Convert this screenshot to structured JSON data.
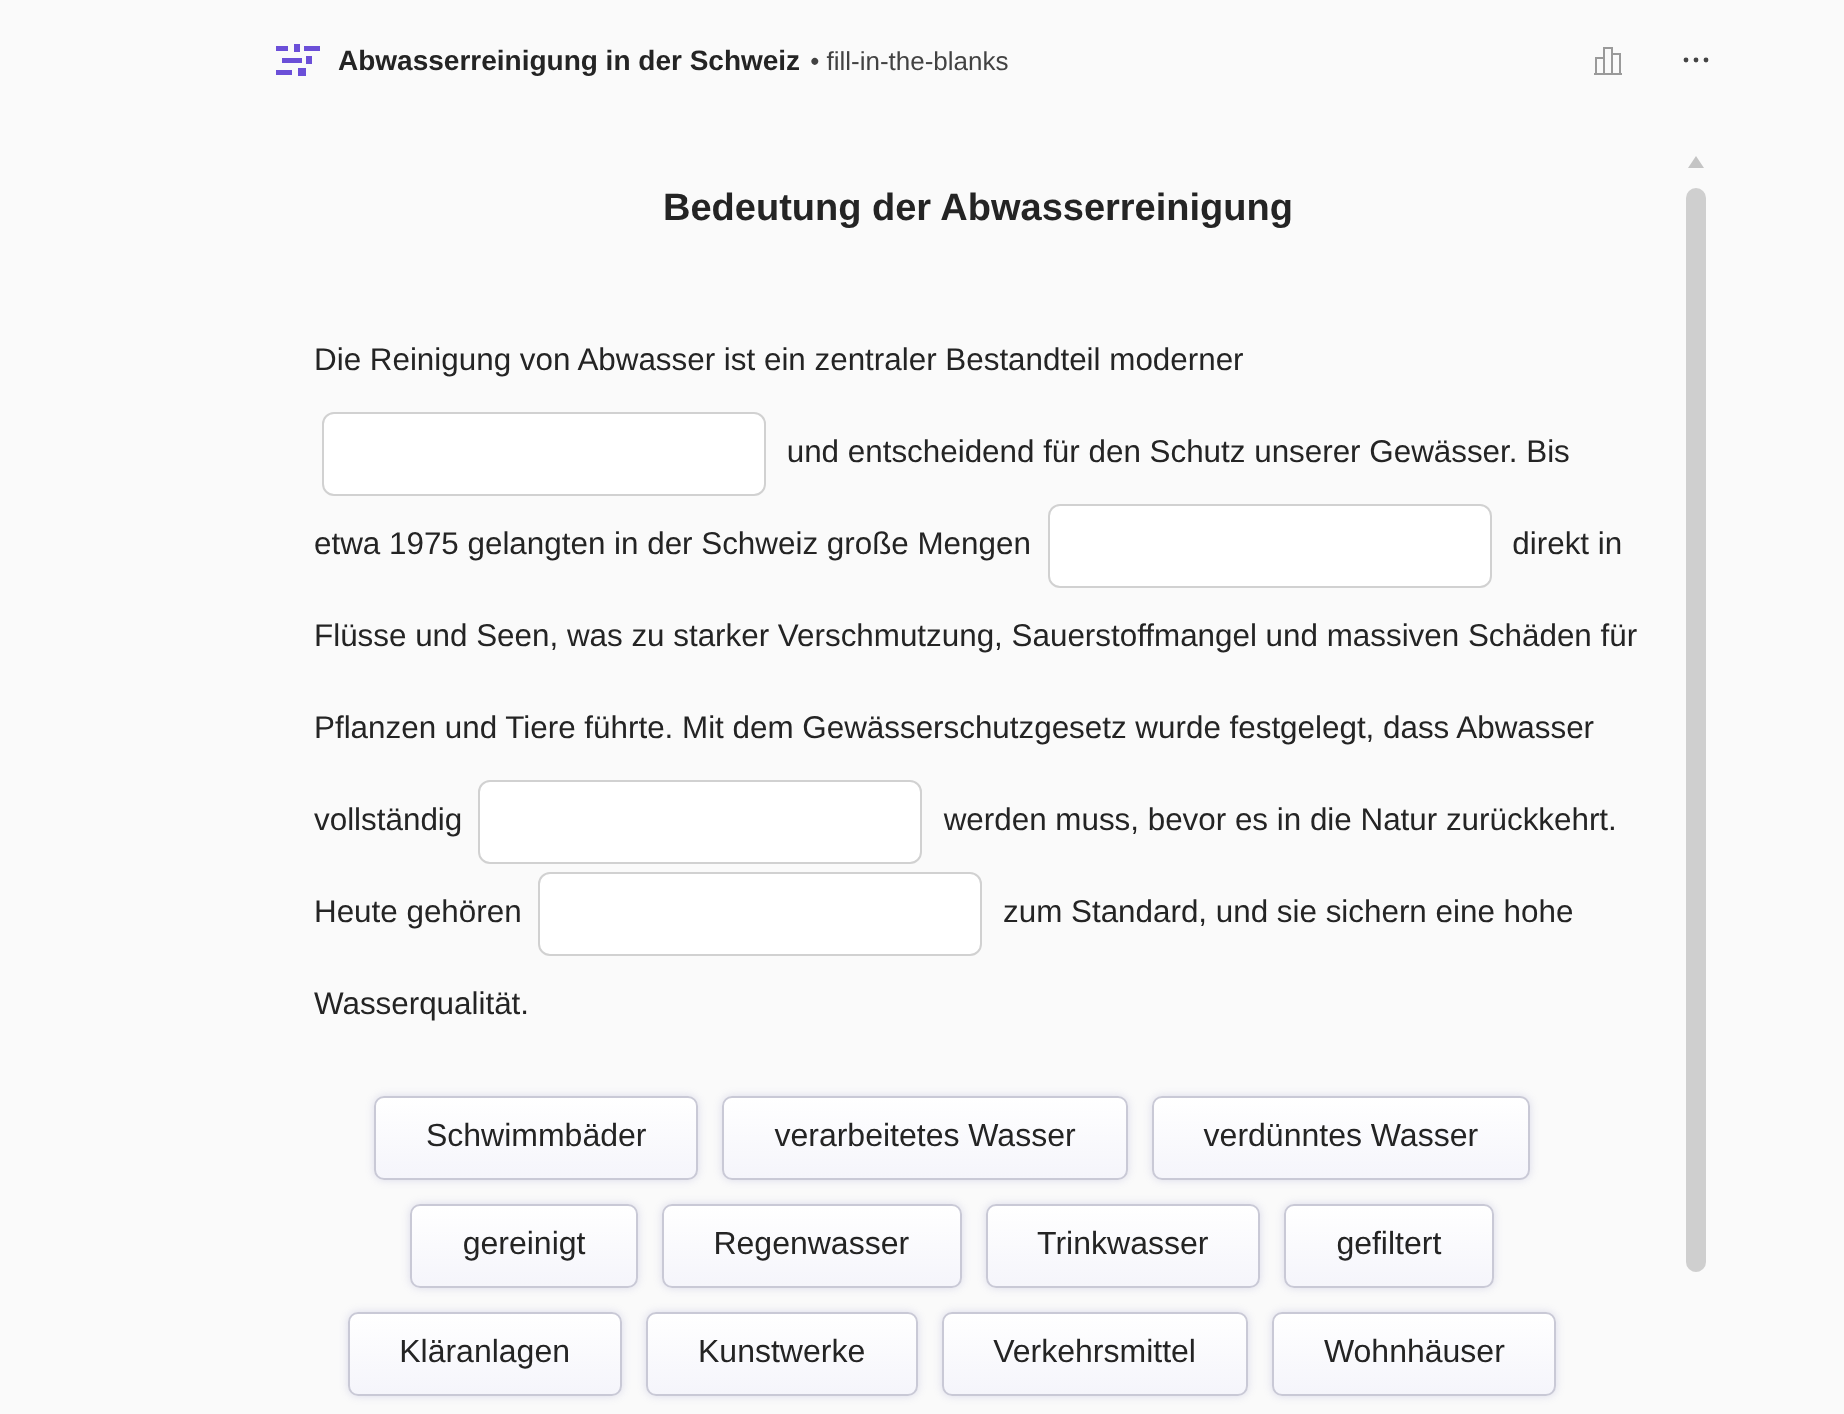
{
  "header": {
    "title": "Abwasserreinigung in der Schweiz",
    "subtitle": "• fill-in-the-blanks"
  },
  "heading": "Bedeutung der Abwasserreinigung",
  "passage": [
    {
      "kind": "text",
      "text": "Die Reinigung von Abwasser ist ein zentraler Bestandteil moderner"
    },
    {
      "kind": "blank"
    },
    {
      "kind": "text",
      "text": "und entscheidend für den Schutz unserer Gewässer. Bis etwa 1975 gelangten in der Schweiz große Mengen"
    },
    {
      "kind": "blank"
    },
    {
      "kind": "text",
      "text": "direkt in Flüsse und Seen, was zu starker Verschmutzung, Sauerstoffmangel und massiven Schäden für Pflanzen und Tiere führte. Mit dem Gewässerschutzgesetz wurde festgelegt, dass Abwasser vollständig"
    },
    {
      "kind": "blank"
    },
    {
      "kind": "text",
      "text": "werden muss, bevor es in die Natur zurückkehrt. Heute gehören"
    },
    {
      "kind": "blank"
    },
    {
      "kind": "text",
      "text": "zum Standard, und sie sichern eine hohe Wasserqualität."
    }
  ],
  "word_bank": [
    [
      "Schwimmbäder",
      "verarbeitetes Wasser",
      "verdünntes Wasser"
    ],
    [
      "gereinigt",
      "Regenwasser",
      "Trinkwasser",
      "gefiltert"
    ],
    [
      "Kläranlagen",
      "Kunstwerke",
      "Verkehrsmittel",
      "Wohnhäuser"
    ]
  ]
}
